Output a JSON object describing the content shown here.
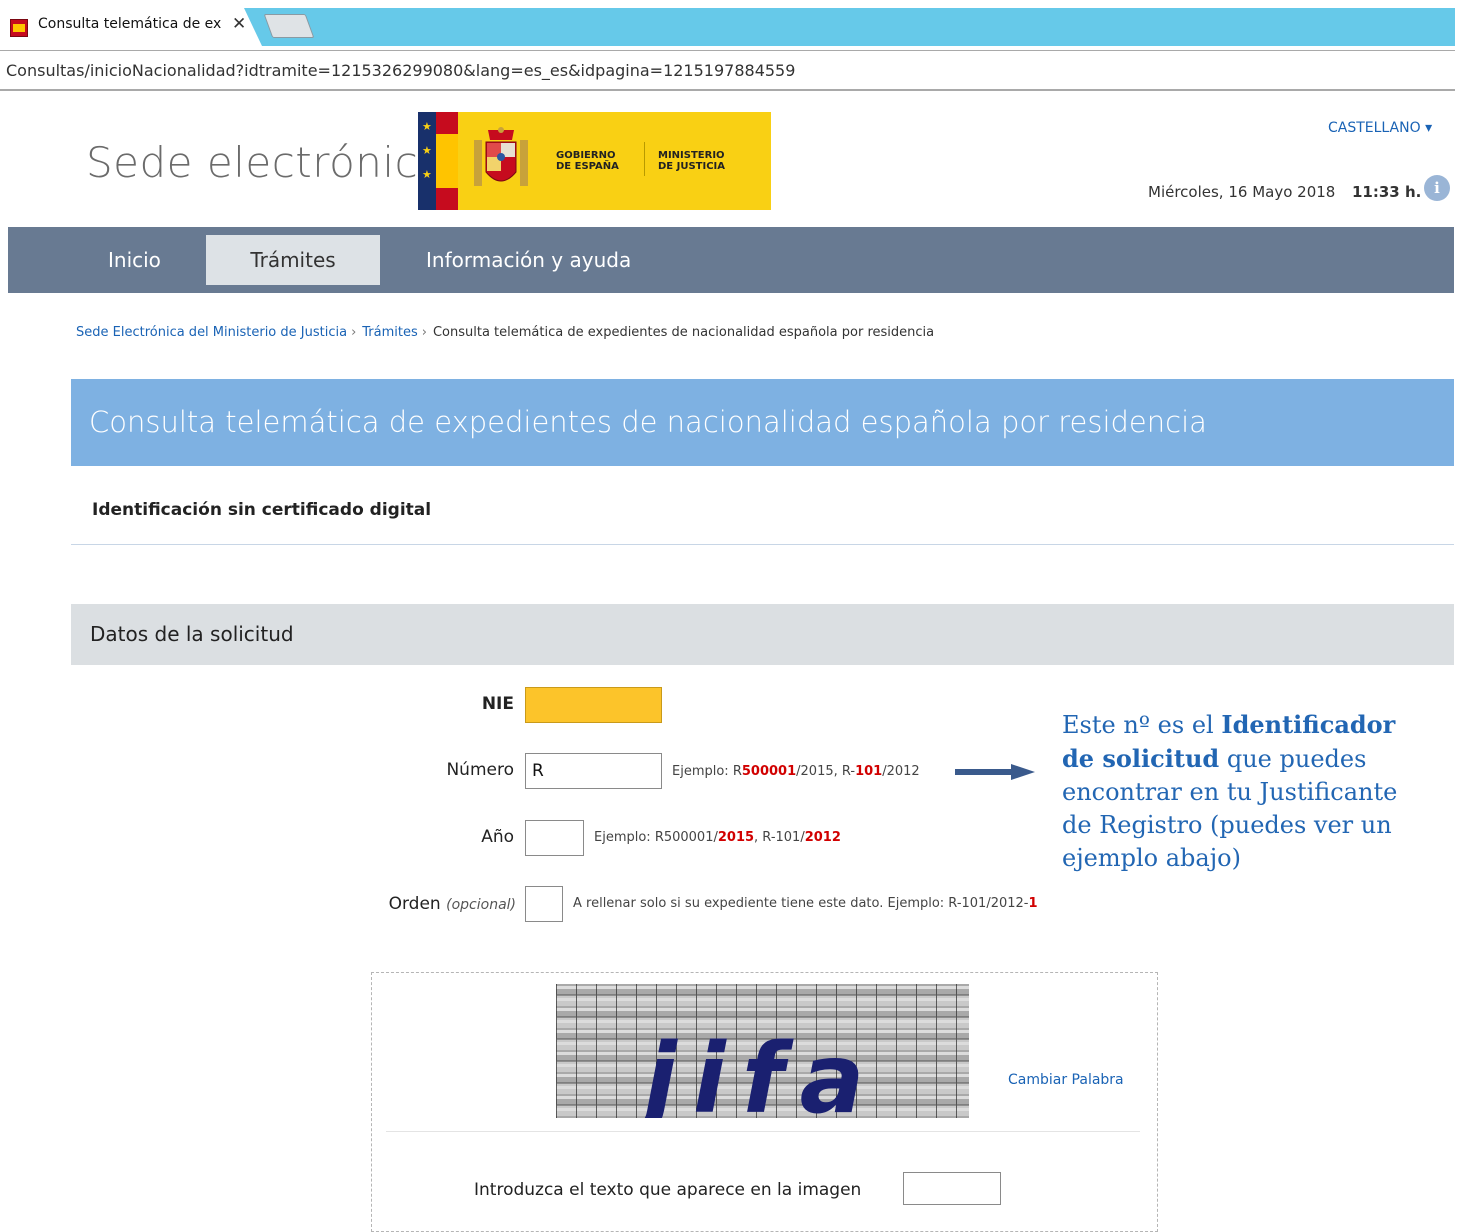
{
  "browser": {
    "tab_title": "Consulta telemática de ex",
    "tab_close": "✕",
    "url": "Consultas/inicioNacionalidad?idtramite=1215326299080&lang=es_es&idpagina=1215197884559"
  },
  "header": {
    "site_title": "Sede electrónica",
    "logo": {
      "gobierno": "GOBIERNO\nDE ESPAÑA",
      "ministerio": "MINISTERIO\nDE JUSTICIA"
    },
    "language": "CASTELLANO ▾",
    "date": "Miércoles, 16 Mayo 2018",
    "time": "11:33 h.",
    "info_icon": "i"
  },
  "nav": {
    "items": [
      {
        "label": "Inicio"
      },
      {
        "label": "Trámites"
      },
      {
        "label": "Información y ayuda"
      }
    ]
  },
  "breadcrumb": {
    "items": [
      "Sede Electrónica del Ministerio de Justicia",
      "Trámites"
    ],
    "separator": "›",
    "current": "Consulta telemática de expedientes de nacionalidad española por residencia"
  },
  "page": {
    "title": "Consulta telemática de expedientes de nacionalidad española por residencia",
    "identification": "Identificación sin certificado digital",
    "section_title": "Datos de la solicitud"
  },
  "form": {
    "nie_label": "NIE",
    "nie_value": "",
    "numero_label": "Número",
    "numero_value": "R",
    "numero_hint": [
      "Ejemplo: R",
      "500001",
      "/2015, R-",
      "101",
      "/2012"
    ],
    "anio_label": "Año",
    "anio_value": "",
    "anio_hint": [
      "Ejemplo: R500001/",
      "2015",
      ", R-101/",
      "2012"
    ],
    "orden_label": "Orden",
    "orden_optional": "(opcional)",
    "orden_value": "",
    "orden_hint": [
      "A rellenar solo si su expediente tiene este dato. Ejemplo: R-101/2012-",
      "1"
    ]
  },
  "annotation": {
    "part1": "Este nº es el ",
    "bold": "Identificador de solicitud",
    "part2": " que puedes encontrar en tu Justificante de Registro (puedes ver un ejemplo abajo)"
  },
  "captcha": {
    "word": "jifa",
    "change_label": "Cambiar Palabra",
    "prompt": "Introduzca el texto que aparece en la imagen",
    "value": ""
  },
  "colors": {
    "nav_bg": "#687a92",
    "title_banner": "#7eb1e2",
    "link": "#1a63b5",
    "nie_highlight": "#fcc42a",
    "hint_red": "#d10000",
    "annotation": "#2266b3"
  }
}
